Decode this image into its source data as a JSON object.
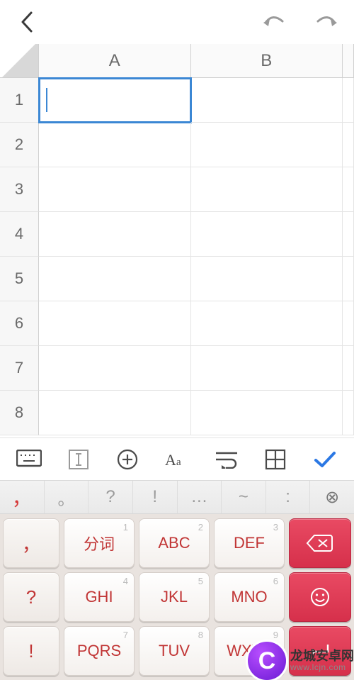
{
  "spreadsheet": {
    "columns": [
      "A",
      "B"
    ],
    "rows": [
      "1",
      "2",
      "3",
      "4",
      "5",
      "6",
      "7",
      "8"
    ],
    "active_cell": "A1",
    "active_value": ""
  },
  "punct": {
    "p0": "，",
    "p1": "。",
    "p2": "?",
    "p3": "!",
    "p4": "…",
    "p5": "~",
    "p6": ":",
    "p7": "⊗"
  },
  "keypad": {
    "side": {
      "s1": "，",
      "s2": "?",
      "s3": "!"
    },
    "k1": {
      "sup": "1",
      "label": "分词"
    },
    "k2": {
      "sup": "2",
      "label": "ABC"
    },
    "k3": {
      "sup": "3",
      "label": "DEF"
    },
    "k4": {
      "sup": "4",
      "label": "GHI"
    },
    "k5": {
      "sup": "5",
      "label": "JKL"
    },
    "k6": {
      "sup": "6",
      "label": "MNO"
    },
    "k7": {
      "sup": "7",
      "label": "PQRS"
    },
    "k8": {
      "sup": "8",
      "label": "TUV"
    },
    "k9": {
      "sup": "9",
      "label": "WXYZ"
    }
  },
  "watermark": {
    "badge": "C",
    "line1": "龙城安卓网",
    "line2": "www.lcjn.com"
  }
}
